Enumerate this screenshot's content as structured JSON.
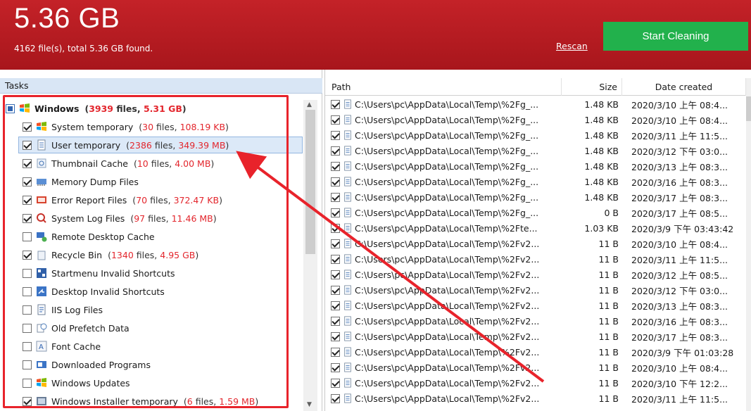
{
  "header": {
    "total_size": "5.36 GB",
    "summary": "4162 file(s), total 5.36 GB found.",
    "rescan_label": "Rescan",
    "start_label": "Start Cleaning"
  },
  "tasks": {
    "title": "Tasks",
    "items": [
      {
        "name": "Windows",
        "files": "3939",
        "size": "5.31 GB",
        "state": "partial",
        "root": true,
        "icon": "windows-icon"
      },
      {
        "name": "System temporary",
        "files": "30",
        "size": "108.19 KB",
        "state": "checked",
        "icon": "windows-flag-icon"
      },
      {
        "name": "User temporary",
        "files": "2386",
        "size": "349.39 MB",
        "state": "checked",
        "selected": true,
        "icon": "file-icon"
      },
      {
        "name": "Thumbnail Cache",
        "files": "10",
        "size": "4.00 MB",
        "state": "checked",
        "icon": "thumbnail-icon"
      },
      {
        "name": "Memory Dump Files",
        "files": "",
        "size": "",
        "state": "checked",
        "icon": "memory-icon"
      },
      {
        "name": "Error Report Files",
        "files": "70",
        "size": "372.47 KB",
        "state": "checked",
        "icon": "error-report-icon"
      },
      {
        "name": "System Log Files",
        "files": "97",
        "size": "11.46 MB",
        "state": "checked",
        "icon": "log-icon"
      },
      {
        "name": "Remote Desktop Cache",
        "files": "",
        "size": "",
        "state": "unchecked",
        "icon": "remote-desktop-icon"
      },
      {
        "name": "Recycle Bin",
        "files": "1340",
        "size": "4.95 GB",
        "state": "checked",
        "icon": "recycle-bin-icon"
      },
      {
        "name": "Startmenu Invalid Shortcuts",
        "files": "",
        "size": "",
        "state": "unchecked",
        "icon": "startmenu-icon"
      },
      {
        "name": "Desktop Invalid Shortcuts",
        "files": "",
        "size": "",
        "state": "unchecked",
        "icon": "desktop-shortcut-icon"
      },
      {
        "name": "IIS Log Files",
        "files": "",
        "size": "",
        "state": "unchecked",
        "icon": "iis-log-icon"
      },
      {
        "name": "Old Prefetch Data",
        "files": "",
        "size": "",
        "state": "unchecked",
        "icon": "prefetch-icon"
      },
      {
        "name": "Font Cache",
        "files": "",
        "size": "",
        "state": "unchecked",
        "icon": "font-icon"
      },
      {
        "name": "Downloaded Programs",
        "files": "",
        "size": "",
        "state": "unchecked",
        "icon": "download-icon"
      },
      {
        "name": "Windows Updates",
        "files": "",
        "size": "",
        "state": "unchecked",
        "icon": "windows-update-icon"
      },
      {
        "name": "Windows Installer temporary",
        "files": "6",
        "size": "1.59 MB",
        "state": "checked",
        "icon": "installer-icon"
      }
    ]
  },
  "files": {
    "columns": {
      "path": "Path",
      "size": "Size",
      "date": "Date created"
    },
    "rows": [
      {
        "path": "C:\\Users\\pc\\AppData\\Local\\Temp\\%2Fg_...",
        "size": "1.48 KB",
        "date": "2020/3/10 上午 08:4..."
      },
      {
        "path": "C:\\Users\\pc\\AppData\\Local\\Temp\\%2Fg_...",
        "size": "1.48 KB",
        "date": "2020/3/10 上午 08:4..."
      },
      {
        "path": "C:\\Users\\pc\\AppData\\Local\\Temp\\%2Fg_...",
        "size": "1.48 KB",
        "date": "2020/3/11 上午 11:5..."
      },
      {
        "path": "C:\\Users\\pc\\AppData\\Local\\Temp\\%2Fg_...",
        "size": "1.48 KB",
        "date": "2020/3/12 下午 03:0..."
      },
      {
        "path": "C:\\Users\\pc\\AppData\\Local\\Temp\\%2Fg_...",
        "size": "1.48 KB",
        "date": "2020/3/13 上午 08:3..."
      },
      {
        "path": "C:\\Users\\pc\\AppData\\Local\\Temp\\%2Fg_...",
        "size": "1.48 KB",
        "date": "2020/3/16 上午 08:3..."
      },
      {
        "path": "C:\\Users\\pc\\AppData\\Local\\Temp\\%2Fg_...",
        "size": "1.48 KB",
        "date": "2020/3/17 上午 08:3..."
      },
      {
        "path": "C:\\Users\\pc\\AppData\\Local\\Temp\\%2Fg_...",
        "size": "0 B",
        "date": "2020/3/17 上午 08:5..."
      },
      {
        "path": "C:\\Users\\pc\\AppData\\Local\\Temp\\%2Fte...",
        "size": "1.03 KB",
        "date": "2020/3/9 下午 03:43:42"
      },
      {
        "path": "C:\\Users\\pc\\AppData\\Local\\Temp\\%2Fv2...",
        "size": "11 B",
        "date": "2020/3/10 上午 08:4..."
      },
      {
        "path": "C:\\Users\\pc\\AppData\\Local\\Temp\\%2Fv2...",
        "size": "11 B",
        "date": "2020/3/11 上午 11:5..."
      },
      {
        "path": "C:\\Users\\pc\\AppData\\Local\\Temp\\%2Fv2...",
        "size": "11 B",
        "date": "2020/3/12 上午 08:5..."
      },
      {
        "path": "C:\\Users\\pc\\AppData\\Local\\Temp\\%2Fv2...",
        "size": "11 B",
        "date": "2020/3/12 下午 03:0..."
      },
      {
        "path": "C:\\Users\\pc\\AppData\\Local\\Temp\\%2Fv2...",
        "size": "11 B",
        "date": "2020/3/13 上午 08:3..."
      },
      {
        "path": "C:\\Users\\pc\\AppData\\Local\\Temp\\%2Fv2...",
        "size": "11 B",
        "date": "2020/3/16 上午 08:3..."
      },
      {
        "path": "C:\\Users\\pc\\AppData\\Local\\Temp\\%2Fv2...",
        "size": "11 B",
        "date": "2020/3/17 上午 08:3..."
      },
      {
        "path": "C:\\Users\\pc\\AppData\\Local\\Temp\\%2Fv2...",
        "size": "11 B",
        "date": "2020/3/9 下午 01:03:28"
      },
      {
        "path": "C:\\Users\\pc\\AppData\\Local\\Temp\\%2Fv2...",
        "size": "11 B",
        "date": "2020/3/10 上午 08:4..."
      },
      {
        "path": "C:\\Users\\pc\\AppData\\Local\\Temp\\%2Fv2...",
        "size": "11 B",
        "date": "2020/3/10 下午 12:2..."
      },
      {
        "path": "C:\\Users\\pc\\AppData\\Local\\Temp\\%2Fv2...",
        "size": "11 B",
        "date": "2020/3/11 上午 11:5..."
      }
    ]
  },
  "colors": {
    "header_red": "#b81c22",
    "accent_green": "#22b14c",
    "stat_red": "#e3262d",
    "annotation_red": "#e8232b"
  }
}
